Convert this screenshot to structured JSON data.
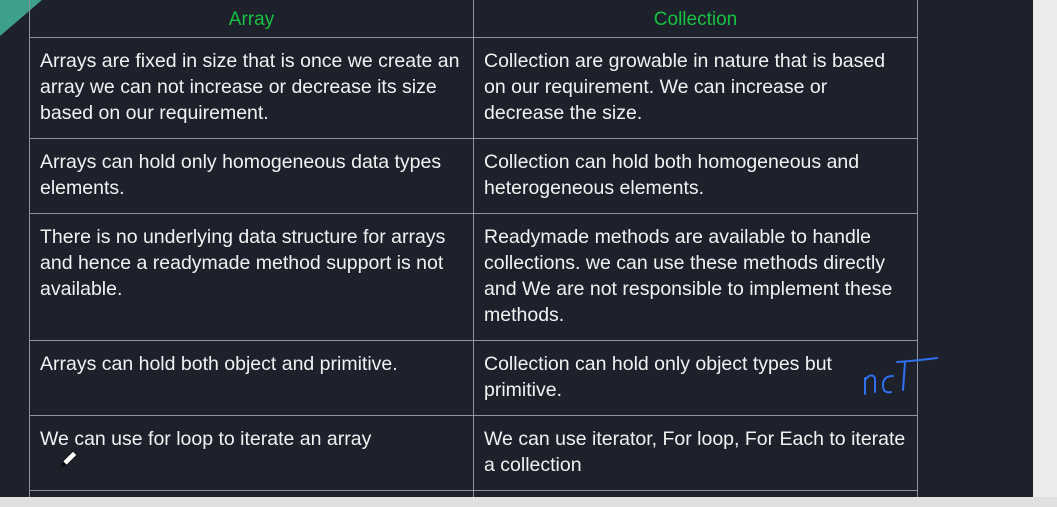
{
  "table": {
    "headers": [
      "Array",
      "Collection"
    ],
    "rows": [
      [
        "Arrays are fixed in size that is once we create an array we can not increase or decrease its size based on our requirement.",
        "Collection are growable in nature that is based on our requirement. We can increase or decrease the size."
      ],
      [
        "Arrays can hold only homogeneous data types elements.",
        "Collection can hold both homogeneous and heterogeneous elements."
      ],
      [
        "There is no underlying data structure for arrays and hence a readymade method support is not available.",
        "Readymade methods are available to handle collections. we can use these methods directly and We are not responsible to implement these methods."
      ],
      [
        "Arrays can hold both object and primitive.",
        "Collection can hold only object types but primitive."
      ],
      [
        "We can use for loop to iterate an array",
        "We can use iterator, For loop, For Each to iterate a collection"
      ]
    ]
  },
  "annotation": {
    "handwritten_text": "not",
    "ink_color": "#2f6ff0"
  },
  "colors": {
    "header_text": "#16c23f",
    "background": "#1c212c",
    "grid": "#8e939c"
  },
  "cursor": {
    "icon": "pen-cursor-icon"
  }
}
